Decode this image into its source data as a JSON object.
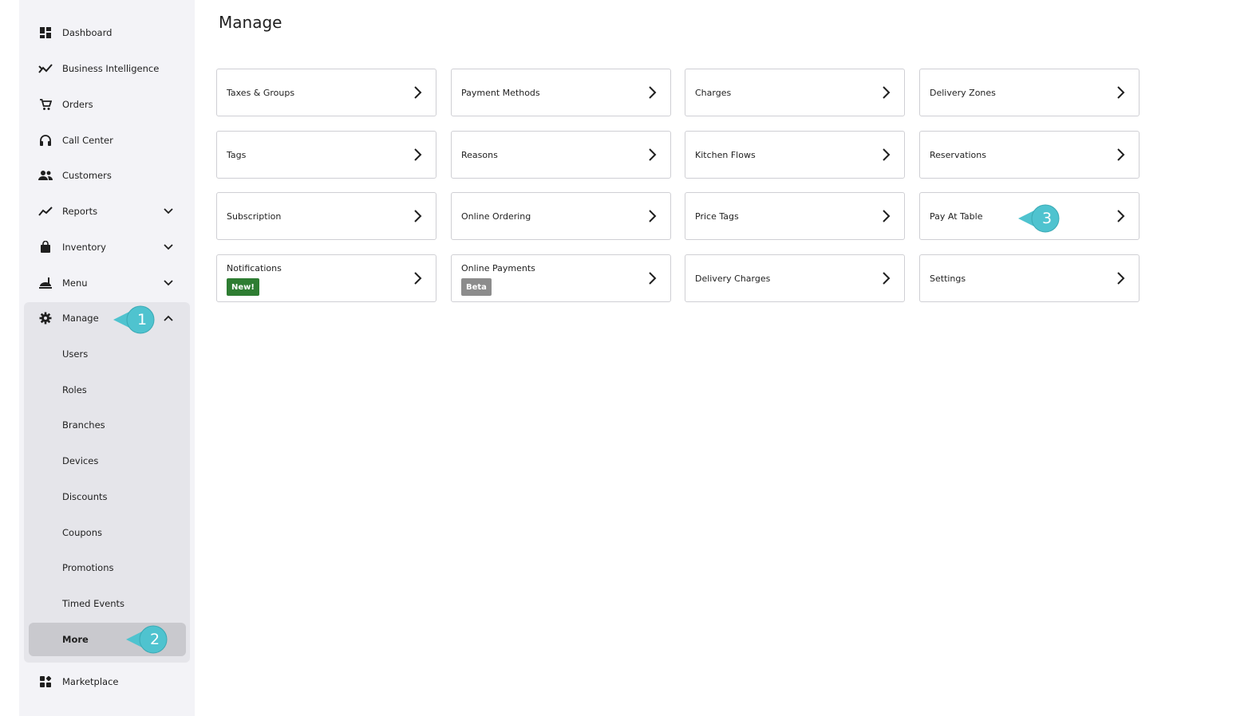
{
  "sidebar": {
    "items": [
      {
        "label": "Dashboard",
        "icon": "dashboard-icon"
      },
      {
        "label": "Business Intelligence",
        "icon": "trending-icon"
      },
      {
        "label": "Orders",
        "icon": "cart-icon"
      },
      {
        "label": "Call Center",
        "icon": "headset-icon"
      },
      {
        "label": "Customers",
        "icon": "people-icon"
      },
      {
        "label": "Reports",
        "icon": "chart-line-icon"
      },
      {
        "label": "Inventory",
        "icon": "bag-icon"
      },
      {
        "label": "Menu",
        "icon": "food-icon"
      },
      {
        "label": "Manage",
        "icon": "gear-icon"
      }
    ],
    "manage_sub": [
      "Users",
      "Roles",
      "Branches",
      "Devices",
      "Discounts",
      "Coupons",
      "Promotions",
      "Timed Events",
      "More"
    ],
    "marketplace": {
      "label": "Marketplace",
      "icon": "apps-icon"
    }
  },
  "main": {
    "title": "Manage",
    "cards": [
      {
        "label": "Taxes & Groups"
      },
      {
        "label": "Payment Methods"
      },
      {
        "label": "Charges"
      },
      {
        "label": "Delivery Zones"
      },
      {
        "label": "Tags"
      },
      {
        "label": "Reasons"
      },
      {
        "label": "Kitchen Flows"
      },
      {
        "label": "Reservations"
      },
      {
        "label": "Subscription"
      },
      {
        "label": "Online Ordering"
      },
      {
        "label": "Price Tags"
      },
      {
        "label": "Pay At Table"
      },
      {
        "label": "Notifications",
        "badge": "New!"
      },
      {
        "label": "Online Payments",
        "badge": "Beta"
      },
      {
        "label": "Delivery Charges"
      },
      {
        "label": "Settings"
      }
    ]
  },
  "callouts": [
    "1",
    "2",
    "3"
  ],
  "colors": {
    "callout": "#4fc3cf",
    "badge_new": "#2e7d32",
    "badge_beta": "#8c8c8c",
    "sidebar_bg": "#f3f3f7"
  }
}
